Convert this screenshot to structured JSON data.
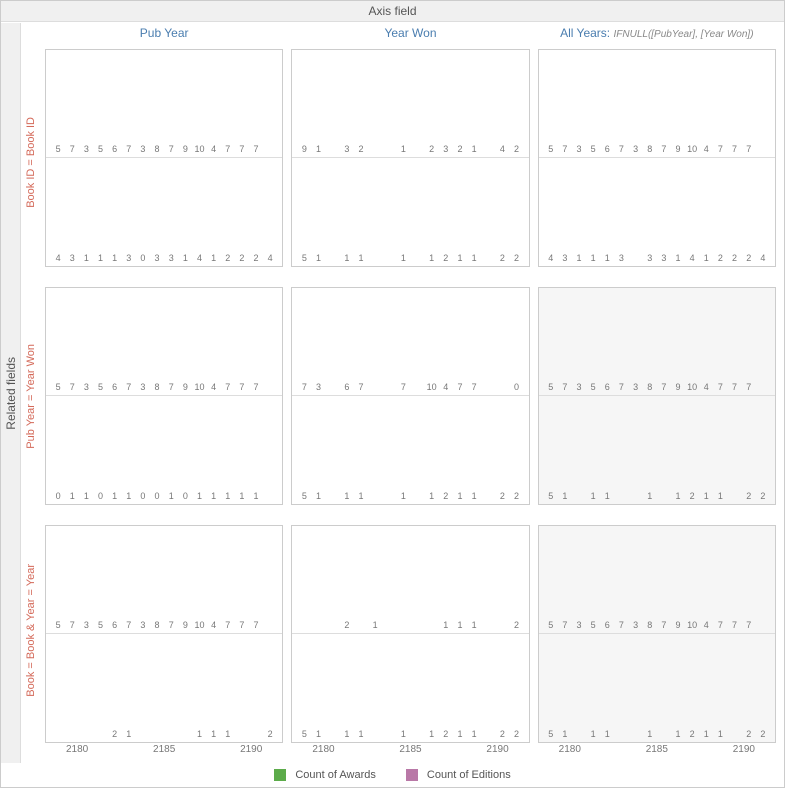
{
  "headers": {
    "top": "Axis field",
    "left": "Related fields",
    "cols": [
      {
        "label": "Pub Year"
      },
      {
        "label": "Year Won"
      },
      {
        "label": "All Years:",
        "formula": "IFNULL([PubYear], [Year Won])"
      }
    ],
    "rows": [
      "Book ID = Book ID",
      "Pub Year = Year Won",
      "Book = Book & Year = Year"
    ]
  },
  "legend": {
    "awards": "Count of Awards",
    "editions": "Count of Editions"
  },
  "colors": {
    "editions": "#b978a7",
    "awards": "#5cab4a"
  },
  "xaxis_ticks": [
    "2180",
    "2185",
    "2190"
  ],
  "chart_data": {
    "type": "bar",
    "note": "Small-multiples grid 3 rows × 3 cols. Each cell has two stacked mini bar charts: top = Count of Editions (purple), bottom = Count of Awards (green). 16 year slots per cell covering ~2178–2193.",
    "max_editions": 10,
    "max_awards": 5,
    "cells": [
      {
        "r": 0,
        "c": 0,
        "shaded": false,
        "editions": [
          5,
          7,
          3,
          5,
          6,
          7,
          3,
          8,
          7,
          9,
          10,
          4,
          7,
          7,
          7,
          null
        ],
        "ed_wide_idx": [
          5
        ],
        "awards": [
          4,
          3,
          1,
          1,
          1,
          3,
          0,
          3,
          3,
          1,
          4,
          1,
          2,
          2,
          2,
          4
        ],
        "aw_wide_idx": []
      },
      {
        "r": 0,
        "c": 1,
        "shaded": false,
        "editions": [
          9,
          1,
          null,
          3,
          2,
          null,
          null,
          1,
          null,
          2,
          3,
          2,
          1,
          null,
          4,
          2
        ],
        "ed_wide_idx": [
          4
        ],
        "awards": [
          5,
          1,
          null,
          1,
          1,
          null,
          null,
          1,
          null,
          1,
          2,
          1,
          1,
          null,
          2,
          2
        ],
        "aw_wide_idx": [
          4
        ]
      },
      {
        "r": 0,
        "c": 2,
        "shaded": false,
        "editions": [
          5,
          7,
          3,
          5,
          6,
          7,
          3,
          8,
          7,
          9,
          10,
          4,
          7,
          7,
          7,
          null
        ],
        "ed_wide_idx": [
          5
        ],
        "awards": [
          4,
          3,
          1,
          1,
          1,
          3,
          null,
          3,
          3,
          1,
          4,
          1,
          2,
          2,
          2,
          4
        ],
        "aw_wide_idx": [
          5
        ]
      },
      {
        "r": 1,
        "c": 0,
        "shaded": false,
        "editions": [
          5,
          7,
          3,
          5,
          6,
          7,
          3,
          8,
          7,
          9,
          10,
          4,
          7,
          7,
          7,
          null
        ],
        "ed_wide_idx": [
          5
        ],
        "awards": [
          0,
          1,
          1,
          0,
          1,
          1,
          0,
          0,
          1,
          0,
          1,
          1,
          1,
          1,
          1,
          null
        ],
        "aw_wide_idx": [
          5
        ]
      },
      {
        "r": 1,
        "c": 1,
        "shaded": false,
        "editions": [
          7,
          3,
          null,
          6,
          7,
          null,
          null,
          7,
          null,
          10,
          4,
          7,
          7,
          null,
          null,
          0
        ],
        "ed_wide_idx": [
          4
        ],
        "awards": [
          5,
          1,
          null,
          1,
          1,
          null,
          null,
          1,
          null,
          1,
          2,
          1,
          1,
          null,
          2,
          2
        ],
        "aw_wide_idx": [
          4
        ]
      },
      {
        "r": 1,
        "c": 2,
        "shaded": true,
        "editions": [
          5,
          7,
          3,
          5,
          6,
          7,
          3,
          8,
          7,
          9,
          10,
          4,
          7,
          7,
          7,
          null
        ],
        "ed_wide_idx": [
          5
        ],
        "awards": [
          5,
          1,
          null,
          1,
          1,
          null,
          null,
          1,
          null,
          1,
          2,
          1,
          1,
          null,
          2,
          2
        ],
        "aw_wide_idx": [
          4
        ]
      },
      {
        "r": 2,
        "c": 0,
        "shaded": false,
        "editions": [
          5,
          7,
          3,
          5,
          6,
          7,
          3,
          8,
          7,
          9,
          10,
          4,
          7,
          7,
          7,
          null
        ],
        "ed_wide_idx": [
          5
        ],
        "awards": [
          null,
          null,
          null,
          null,
          2,
          1,
          null,
          null,
          null,
          null,
          1,
          1,
          1,
          null,
          null,
          2
        ],
        "aw_wide_idx": [
          5
        ]
      },
      {
        "r": 2,
        "c": 1,
        "shaded": false,
        "editions": [
          null,
          null,
          null,
          2,
          null,
          1,
          null,
          null,
          null,
          null,
          1,
          1,
          1,
          null,
          null,
          2
        ],
        "ed_wide_idx": [
          5
        ],
        "awards": [
          5,
          1,
          null,
          1,
          1,
          null,
          null,
          1,
          null,
          1,
          2,
          1,
          1,
          null,
          2,
          2
        ],
        "aw_wide_idx": [
          4
        ]
      },
      {
        "r": 2,
        "c": 2,
        "shaded": true,
        "editions": [
          5,
          7,
          3,
          5,
          6,
          7,
          3,
          8,
          7,
          9,
          10,
          4,
          7,
          7,
          7,
          null
        ],
        "ed_wide_idx": [
          5
        ],
        "awards": [
          5,
          1,
          null,
          1,
          1,
          null,
          null,
          1,
          null,
          1,
          2,
          1,
          1,
          null,
          2,
          2
        ],
        "aw_wide_idx": [
          4
        ]
      }
    ]
  }
}
